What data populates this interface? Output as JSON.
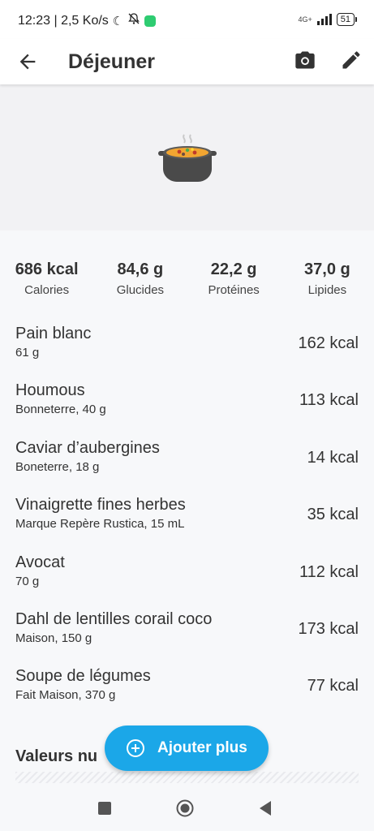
{
  "status_bar": {
    "time_speed": "12:23 | 2,5 Ko/s",
    "network_label": "4G+",
    "battery": "51"
  },
  "app_bar": {
    "title": "Déjeuner"
  },
  "summary": [
    {
      "value": "686 kcal",
      "label": "Calories"
    },
    {
      "value": "84,6 g",
      "label": "Glucides"
    },
    {
      "value": "22,2 g",
      "label": "Protéines"
    },
    {
      "value": "37,0 g",
      "label": "Lipides"
    }
  ],
  "foods": [
    {
      "name": "Pain blanc",
      "detail": "61 g",
      "kcal": "162 kcal"
    },
    {
      "name": "Houmous",
      "detail": "Bonneterre, 40 g",
      "kcal": "113 kcal"
    },
    {
      "name": "Caviar d’aubergines",
      "detail": "Boneterre, 18 g",
      "kcal": "14 kcal"
    },
    {
      "name": "Vinaigrette fines herbes",
      "detail": "Marque Repère Rustica, 15 mL",
      "kcal": "35 kcal"
    },
    {
      "name": "Avocat",
      "detail": "70 g",
      "kcal": "112 kcal"
    },
    {
      "name": "Dahl de lentilles corail coco",
      "detail": "Maison, 150 g",
      "kcal": "173 kcal"
    },
    {
      "name": "Soupe de légumes",
      "detail": "Fait Maison, 370 g",
      "kcal": "77 kcal"
    }
  ],
  "nutrition_section_title": "Valeurs nu",
  "fab": {
    "label": "Ajouter plus"
  },
  "colors": {
    "accent": "#1ba7e8",
    "text": "#333333",
    "hero_bg": "#f2f2f4"
  },
  "icons": [
    "moon-icon",
    "bell-off-icon",
    "app-icon",
    "back-arrow-icon",
    "camera-icon",
    "edit-pencil-icon",
    "pot-emoji-icon",
    "add-circle-icon",
    "nav-recents-icon",
    "nav-home-icon",
    "nav-back-icon"
  ]
}
